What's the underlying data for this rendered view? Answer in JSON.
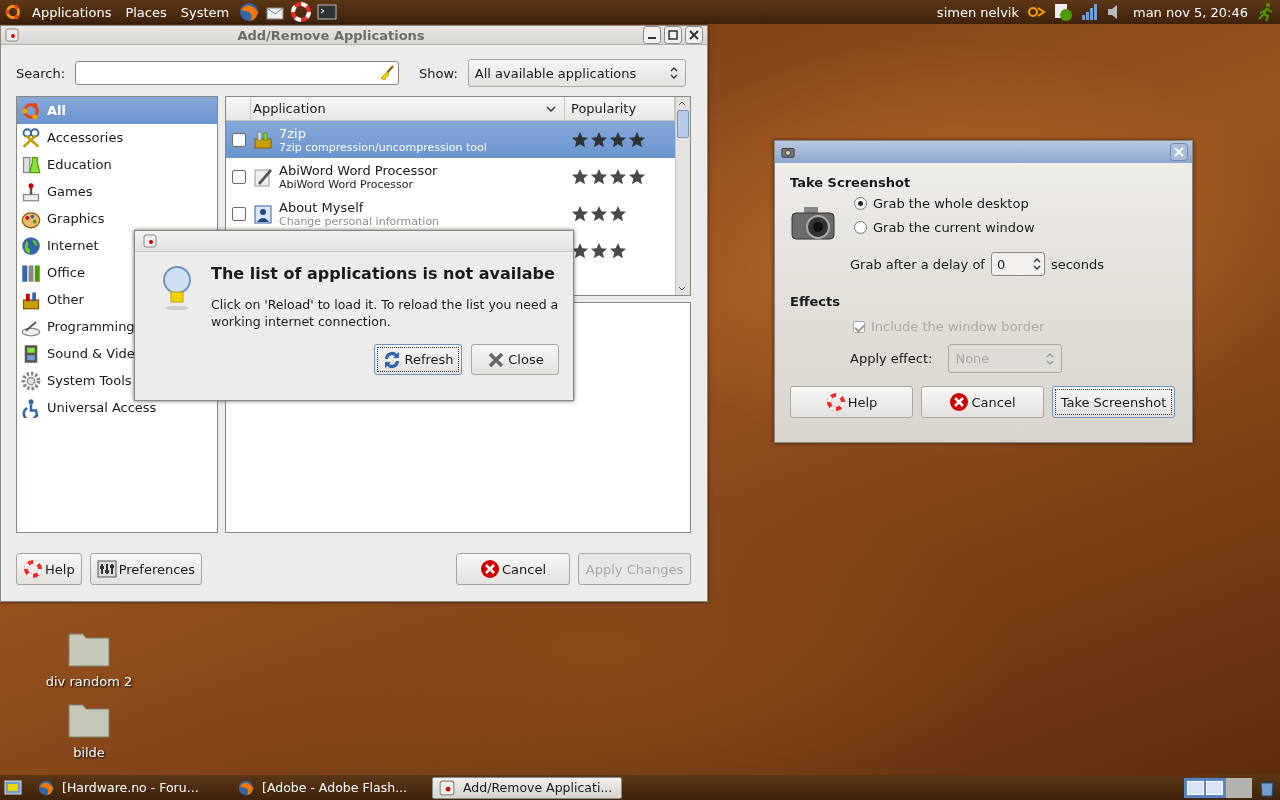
{
  "top_panel": {
    "menus": [
      {
        "label": "Applications"
      },
      {
        "label": "Places"
      },
      {
        "label": "System"
      }
    ],
    "user": "simen nelvik",
    "clock": "man nov  5, 20:46"
  },
  "main_window": {
    "title": "Add/Remove Applications",
    "search": {
      "label": "Search:"
    },
    "show": {
      "label": "Show:",
      "value": "All available applications"
    },
    "categories": [
      {
        "label": "All",
        "selected": true
      },
      {
        "label": "Accessories",
        "selected": false
      },
      {
        "label": "Education",
        "selected": false
      },
      {
        "label": "Games",
        "selected": false
      },
      {
        "label": "Graphics",
        "selected": false
      },
      {
        "label": "Internet",
        "selected": false
      },
      {
        "label": "Office",
        "selected": false
      },
      {
        "label": "Other",
        "selected": false
      },
      {
        "label": "Programming",
        "selected": false
      },
      {
        "label": "Sound & Vide",
        "selected": false
      },
      {
        "label": "System Tools",
        "selected": false
      },
      {
        "label": "Universal Access",
        "selected": false
      }
    ],
    "columns": [
      "Application",
      "Popularity"
    ],
    "apps": [
      {
        "name": "7zip",
        "description": "7zip compression/uncompression tool",
        "checked": false,
        "selected": true,
        "stars": 4
      },
      {
        "name": "AbiWord Word Processor",
        "description": "AbiWord Word Processor",
        "checked": false,
        "selected": false,
        "stars": 4
      },
      {
        "name": "About Myself",
        "description": "Change personal information",
        "checked": false,
        "selected": false,
        "stars": 3
      },
      {
        "selected": false,
        "stars": 3
      }
    ],
    "buttons": [
      {
        "label": "Help",
        "kind": "help",
        "disabled": false
      },
      {
        "label": "Preferences",
        "kind": "preferences",
        "disabled": false
      },
      {
        "label": "Cancel",
        "kind": "cancel",
        "disabled": false
      },
      {
        "label": "Apply Changes",
        "kind": "apply",
        "disabled": true
      }
    ]
  },
  "dialog": {
    "title": "The list of applications is not availabe",
    "message": "Click on 'Reload' to load it. To reload the list you need a working internet connection.",
    "buttons": [
      {
        "label": "Refresh",
        "kind": "refresh",
        "focused": true
      },
      {
        "label": "Close",
        "kind": "close",
        "focused": false
      }
    ]
  },
  "screenshot_window": {
    "heading": "Take Screenshot",
    "options": [
      {
        "label": "Grab the whole desktop",
        "selected": true
      },
      {
        "label": "Grab the current window",
        "selected": false
      }
    ],
    "delay": {
      "label": "Grab after a delay of",
      "value": "0",
      "unit": "seconds"
    },
    "effects_heading": "Effects",
    "include_border": {
      "label": "Include the window border",
      "checked": true,
      "disabled": true
    },
    "apply_effect": {
      "label": "Apply effect:",
      "value": "None",
      "disabled": true
    },
    "buttons": [
      {
        "label": "Help",
        "kind": "help",
        "focused": false
      },
      {
        "label": "Cancel",
        "kind": "cancel",
        "focused": false
      },
      {
        "label": "Take Screenshot",
        "kind": "take",
        "focused": true
      }
    ]
  },
  "desktop_icons": [
    {
      "label": "div random 2"
    },
    {
      "label": "bilde"
    }
  ],
  "taskbar": {
    "tasks": [
      {
        "label": "[Hardware.no - Foru...",
        "kind": "browser",
        "selected": false
      },
      {
        "label": "[Adobe - Adobe Flash...",
        "kind": "browser",
        "selected": false
      },
      {
        "label": "Add/Remove Applicati...",
        "kind": "installer",
        "selected": true
      }
    ]
  }
}
